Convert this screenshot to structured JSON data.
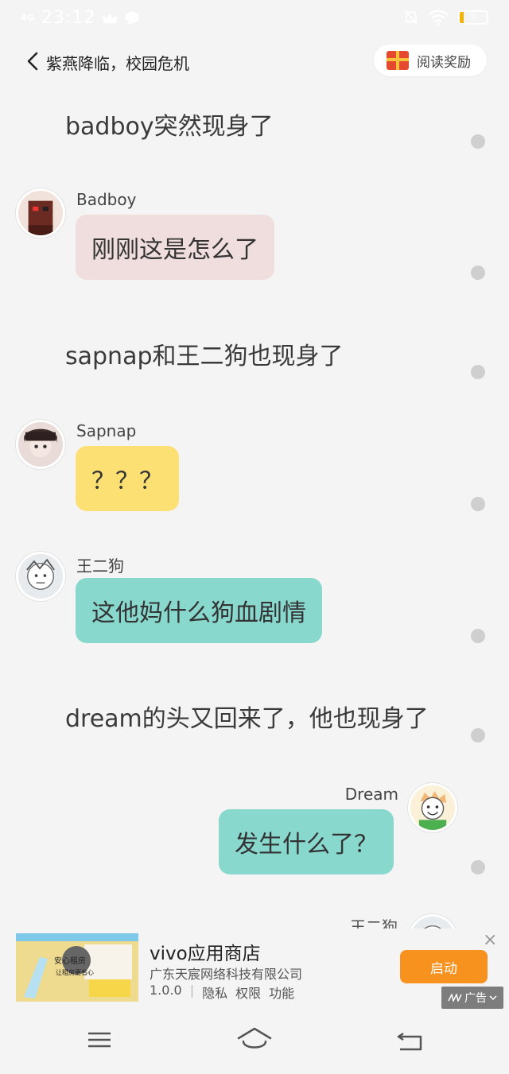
{
  "status_bar": {
    "network": "4G",
    "time": "23:12",
    "battery": "9"
  },
  "header": {
    "title": "紫燕降临，校园危机",
    "reward_label": "阅读奖励"
  },
  "chat": {
    "narrations": [
      "badboy突然现身了",
      "sapnap和王二狗也现身了",
      "dream的头又回来了，他也现身了"
    ],
    "messages": [
      {
        "speaker": "Badboy",
        "text": "刚刚这是怎么了",
        "color": "#f0dede"
      },
      {
        "speaker": "Sapnap",
        "text": "？？？",
        "color": "#fde074"
      },
      {
        "speaker": "王二狗",
        "text": "这他妈什么狗血剧情",
        "color": "#88d8ce"
      },
      {
        "speaker": "Dream",
        "text": "发生什么了？",
        "color": "#88d8ce"
      }
    ],
    "partial_speaker": "王二狗"
  },
  "ad": {
    "app_name": "vivo应用商店",
    "company": "广东天宸网络科技有限公司",
    "version": "1.0.0",
    "links": [
      "隐私",
      "权限",
      "功能"
    ],
    "open_label": "启动",
    "badge": "广告",
    "close": "×",
    "thumb_text": "安心租房",
    "thumb_subtext": "让租房更省心"
  },
  "colors": {
    "background": "#f4f4f4",
    "accent": "#f7921e"
  }
}
